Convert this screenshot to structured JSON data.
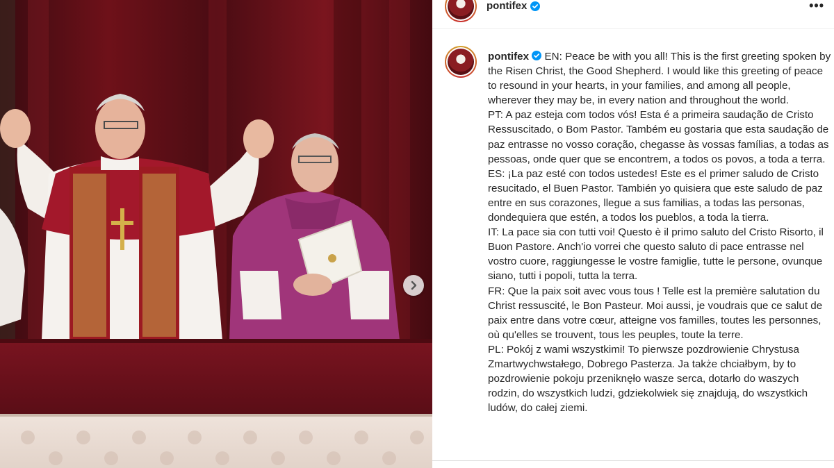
{
  "account": {
    "username": "pontifex",
    "verified": true,
    "verified_icon": "verified-badge-icon",
    "more_icon": "more-options-icon",
    "more_label": "•••"
  },
  "post": {
    "carousel_next_icon": "chevron-right-icon",
    "caption": [
      {
        "id": "en",
        "text": "EN: Peace be with you all! This is the first greeting spoken by the Risen Christ, the Good Shepherd. I would like this greeting of peace to resound in your hearts, in your families, and among all people, wherever they may be, in every nation and throughout the world."
      },
      {
        "id": "pt",
        "text": "PT: A paz esteja com todos vós! Esta é a primeira saudação de Cristo Ressuscitado, o Bom Pastor. Também eu gostaria que esta saudação de paz entrasse no vosso coração, chegasse às vossas famílias, a todas as pessoas, onde quer que se encontrem, a todos os povos, a toda a terra."
      },
      {
        "id": "es",
        "text": "ES: ¡La paz esté con todos ustedes! Este es el primer saludo de Cristo resucitado, el Buen Pastor. También yo quisiera que este saludo de paz entre en sus corazones, llegue a sus familias, a todas las personas, dondequiera que estén, a todos los pueblos, a toda la tierra."
      },
      {
        "id": "it",
        "text": "IT: La pace sia con tutti voi! Questo è il primo saluto del Cristo Risorto, il Buon Pastore. Anch'io vorrei che questo saluto di pace entrasse nel vostro cuore, raggiungesse le vostre famiglie, tutte le persone, ovunque siano, tutti i popoli, tutta la terra."
      },
      {
        "id": "fr",
        "text": "FR: Que la paix soit avec vous tous ! Telle est la première salutation du Christ ressuscité, le Bon Pasteur. Moi aussi, je voudrais que ce salut de paix entre dans votre cœur, atteigne vos familles, toutes les personnes, où qu'elles se trouvent, tous les peuples, toute la terre."
      },
      {
        "id": "pl",
        "text": "PL: Pokój z wami wszystkimi! To pierwsze pozdrowienie Chrystusa Zmartwychwstałego, Dobrego Pasterza. Ja także chciałbym, by to pozdrowienie pokoju przeniknęło wasze serca, dotarło do waszych rodzin, do wszystkich ludzi, gdziekolwiek się znajdują, do wszystkich ludów, do całej ziemi."
      }
    ]
  },
  "colors": {
    "verified_blue": "#0095f6",
    "text": "#262626",
    "curtain_red": "#6e1119",
    "cassock_magenta": "#a0357a",
    "stole_red": "#a3182b"
  }
}
